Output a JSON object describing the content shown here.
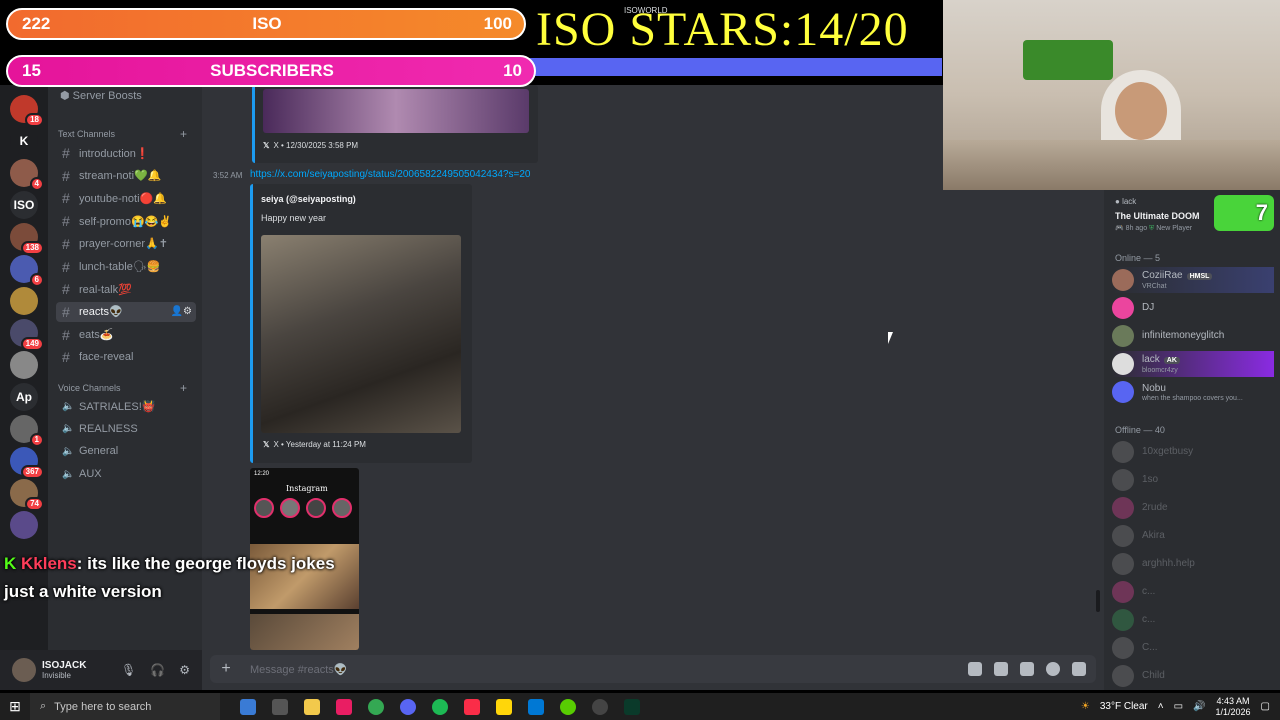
{
  "overlay": {
    "iso_bar": {
      "left": "222",
      "label": "ISO",
      "right": "100"
    },
    "subs_bar": {
      "left": "15",
      "label": "SUBSCRIBERS",
      "right": "10"
    },
    "stars_text": "ISO STARS:14/20",
    "isoworld": "ISOWORLD",
    "chat": {
      "user": "Kklens",
      "message": ": its like the george floyds jokes just a white version"
    }
  },
  "servers": [
    {
      "icon": "",
      "color": "#c0392b",
      "badge": "18"
    },
    {
      "icon": "K",
      "color": "#1e1f22",
      "badge": ""
    },
    {
      "icon": "",
      "color": "#8e5b4a",
      "badge": "4"
    },
    {
      "icon": "ISO",
      "color": "#2b2d31",
      "badge": ""
    },
    {
      "icon": "",
      "color": "#7b4b3a",
      "badge": "138"
    },
    {
      "icon": "",
      "color": "#4b5bb0",
      "badge": "6"
    },
    {
      "icon": "",
      "color": "#b08a3a",
      "badge": ""
    },
    {
      "icon": "",
      "color": "#4a4a6a",
      "badge": "149"
    },
    {
      "icon": "",
      "color": "#888",
      "badge": ""
    },
    {
      "icon": "Ap",
      "color": "#2b2d31",
      "badge": ""
    },
    {
      "icon": "",
      "color": "#666",
      "badge": "1"
    },
    {
      "icon": "",
      "color": "#3b58b8",
      "badge": "367"
    },
    {
      "icon": "",
      "color": "#8a6a4a",
      "badge": "74"
    },
    {
      "icon": "",
      "color": "#5a4a8a",
      "badge": ""
    }
  ],
  "sidebar": {
    "boost": "Server Boosts",
    "text_cat": "Text Channels",
    "voice_cat": "Voice Channels",
    "text_channels": [
      "introduction❗",
      "stream-noti💚🔔",
      "youtube-noti🔴🔔",
      "self-promo😭😂✌",
      "prayer-corner🙏✝",
      "lunch-table🗣🍔",
      "real-talk💯",
      "reacts👽",
      "eats🍝",
      "face-reveal"
    ],
    "voice_channels": [
      "SATRIALES!👹",
      "REALNESS",
      "General",
      "AUX"
    ]
  },
  "messages": {
    "embed1_footer": "X • 12/30/2025 3:58 PM",
    "time": "3:52 AM",
    "link": "https://x.com/seiyaposting/status/2006582249505042434?s=20",
    "embed2_author": "seiya (@seiyaposting)",
    "embed2_desc": "Happy new year",
    "embed2_footer": "X • Yesterday at 11:24 PM",
    "ig_header": "Instagram",
    "ig_time": "12:20"
  },
  "composer": {
    "placeholder": "Message #reacts👽"
  },
  "user_panel": {
    "name": "ISOJACK",
    "status": "Invisible"
  },
  "activity": {
    "user": "lack",
    "title": "The Ultimate DOOM",
    "meta": "8h ago",
    "meta2": "New Player",
    "badge": "7"
  },
  "members": {
    "online_label": "Online — 5",
    "offline_label": "Offline — 40",
    "online": [
      {
        "name": "CoziiRae",
        "tag": "HMSL",
        "sub": "VRChat",
        "color": "#9b6b5a"
      },
      {
        "name": "DJ",
        "tag": "",
        "sub": "",
        "color": "#eb459e"
      },
      {
        "name": "infinitemoneyglitch",
        "tag": "",
        "sub": "",
        "color": "#6a7a5a"
      },
      {
        "name": "lack",
        "tag": "AK",
        "sub": "bloomcr4zy",
        "color": "#ddd"
      },
      {
        "name": "Nobu",
        "tag": "",
        "sub": "when the shampoo covers you...",
        "color": "#5865f2"
      }
    ],
    "offline": [
      {
        "name": "10xgetbusy",
        "color": "#888"
      },
      {
        "name": "1so",
        "color": "#888"
      },
      {
        "name": "2rude",
        "color": "#eb459e"
      },
      {
        "name": "Akira",
        "color": "#888"
      },
      {
        "name": "arghhh.help",
        "color": "#888"
      },
      {
        "name": "c...",
        "color": "#eb459e"
      },
      {
        "name": "c...",
        "color": "#3ba55c"
      },
      {
        "name": "C...",
        "color": "#888"
      },
      {
        "name": "Child",
        "color": "#888"
      }
    ]
  },
  "taskbar": {
    "search": "Type here to search",
    "weather": "33°F  Clear",
    "time": "4:43 AM",
    "date": "1/1/2026"
  }
}
